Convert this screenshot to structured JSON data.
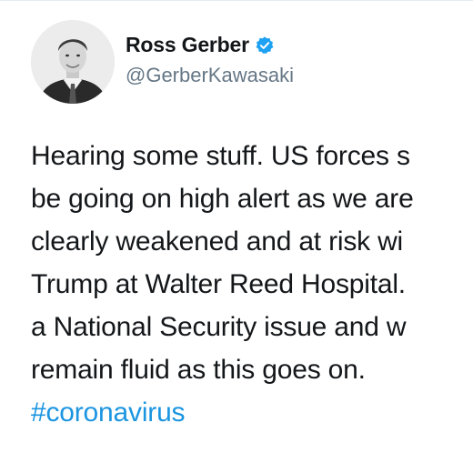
{
  "author": {
    "display_name": "Ross Gerber",
    "handle": "@GerberKawasaki",
    "verified": true,
    "verified_badge_color": "#1da1f2"
  },
  "tweet": {
    "lines": [
      "Hearing some stuff. US forces s",
      "be going on high alert as we are",
      "clearly weakened and at risk wi",
      "Trump at Walter Reed Hospital.",
      "a National Security issue and w",
      "remain fluid as this goes on."
    ],
    "hashtag": "#coronavirus",
    "text_color": "#14171a",
    "hashtag_color": "#1b95e0"
  }
}
